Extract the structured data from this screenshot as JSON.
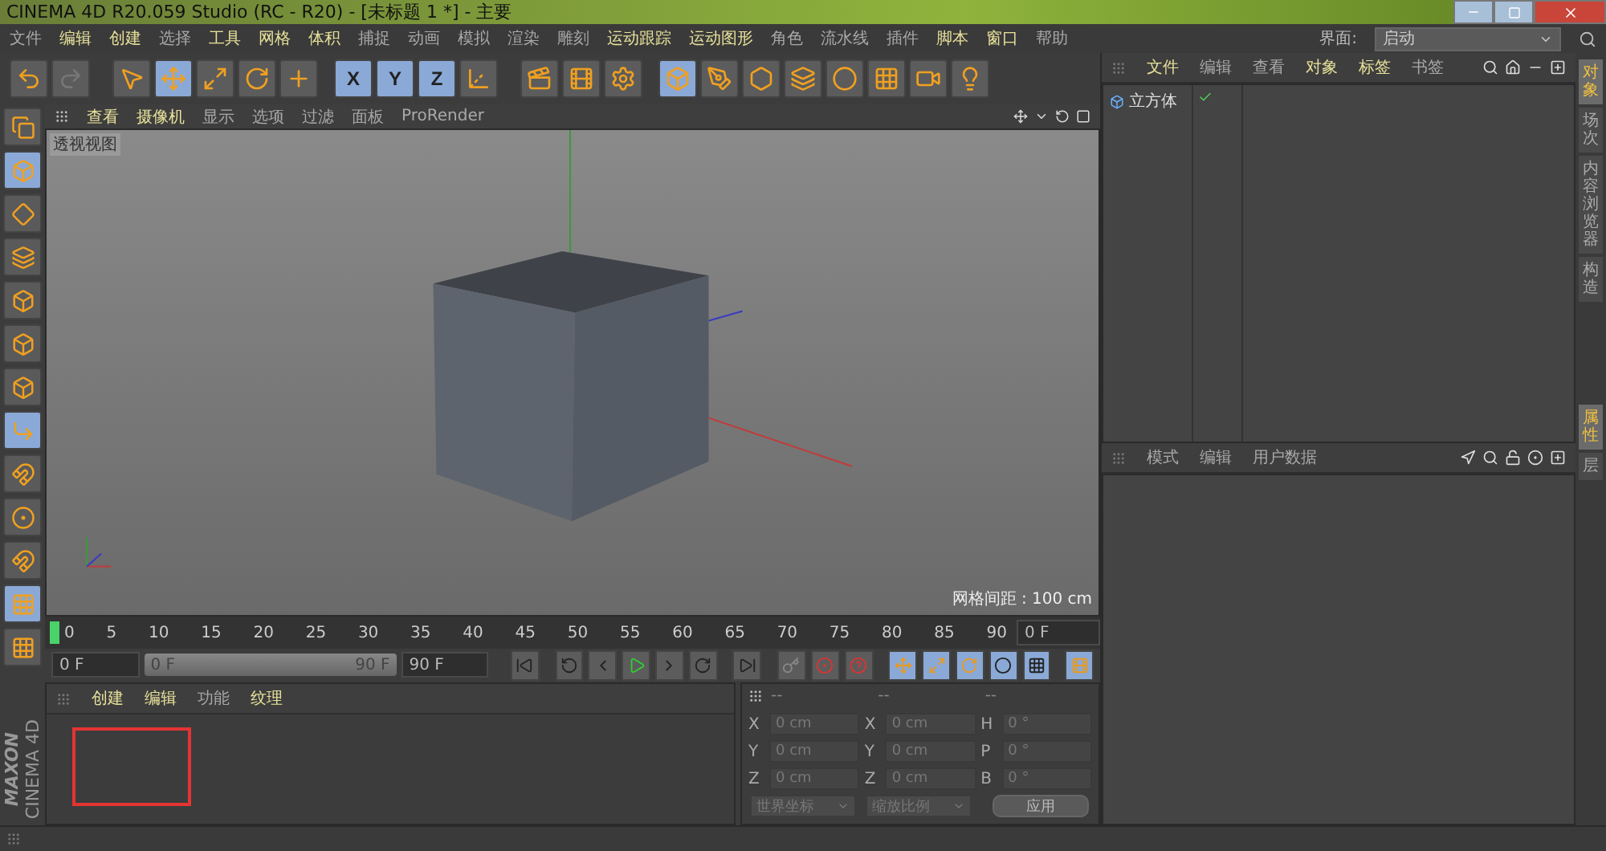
{
  "window": {
    "title": "CINEMA 4D R20.059 Studio (RC - R20) - [未标题 1 *] - 主要"
  },
  "menu": [
    {
      "label": "文件",
      "highlighted": false
    },
    {
      "label": "编辑",
      "highlighted": true
    },
    {
      "label": "创建",
      "highlighted": true
    },
    {
      "label": "选择",
      "highlighted": false
    },
    {
      "label": "工具",
      "highlighted": true
    },
    {
      "label": "网格",
      "highlighted": true
    },
    {
      "label": "体积",
      "highlighted": true
    },
    {
      "label": "捕捉",
      "highlighted": false
    },
    {
      "label": "动画",
      "highlighted": false
    },
    {
      "label": "模拟",
      "highlighted": false
    },
    {
      "label": "渲染",
      "highlighted": false
    },
    {
      "label": "雕刻",
      "highlighted": false
    },
    {
      "label": "运动跟踪",
      "highlighted": true
    },
    {
      "label": "运动图形",
      "highlighted": true
    },
    {
      "label": "角色",
      "highlighted": false
    },
    {
      "label": "流水线",
      "highlighted": false
    },
    {
      "label": "插件",
      "highlighted": false
    },
    {
      "label": "脚本",
      "highlighted": true
    },
    {
      "label": "窗口",
      "highlighted": true
    },
    {
      "label": "帮助",
      "highlighted": false
    }
  ],
  "layout_selector": {
    "label": "界面:",
    "value": "启动"
  },
  "toolbar": [
    {
      "kind": "icon",
      "active": false
    },
    {
      "kind": "icon",
      "active": false
    },
    {
      "kind": "icon",
      "active": false
    },
    {
      "kind": "icon",
      "active": true
    },
    {
      "kind": "icon",
      "active": false
    },
    {
      "kind": "icon",
      "active": false
    },
    {
      "kind": "icon",
      "active": false
    },
    {
      "kind": "axis",
      "label": "X",
      "active": true
    },
    {
      "kind": "axis",
      "label": "Y",
      "active": true
    },
    {
      "kind": "axis",
      "label": "Z",
      "active": true
    },
    {
      "kind": "icon",
      "active": false
    },
    {
      "kind": "icon",
      "active": false
    },
    {
      "kind": "icon",
      "active": false
    },
    {
      "kind": "icon",
      "active": false
    },
    {
      "kind": "icon",
      "active": true
    },
    {
      "kind": "icon",
      "active": false
    },
    {
      "kind": "icon",
      "active": false
    },
    {
      "kind": "icon",
      "active": false
    },
    {
      "kind": "icon",
      "active": false
    },
    {
      "kind": "icon",
      "active": false
    },
    {
      "kind": "icon",
      "active": false
    },
    {
      "kind": "icon",
      "active": false
    }
  ],
  "left_tools": [
    {
      "active": false
    },
    {
      "active": true
    },
    {
      "active": false
    },
    {
      "active": false
    },
    {
      "active": false
    },
    {
      "active": false
    },
    {
      "active": false
    },
    {
      "active": true
    },
    {
      "active": false
    },
    {
      "active": false
    },
    {
      "active": false
    },
    {
      "active": true
    },
    {
      "active": false
    }
  ],
  "viewport": {
    "menu": [
      {
        "label": "查看",
        "highlighted": true
      },
      {
        "label": "摄像机",
        "highlighted": true
      },
      {
        "label": "显示",
        "highlighted": false
      },
      {
        "label": "选项",
        "highlighted": false
      },
      {
        "label": "过滤",
        "highlighted": false
      },
      {
        "label": "面板",
        "highlighted": false
      },
      {
        "label": "ProRender",
        "highlighted": false
      }
    ],
    "view_name": "透视视图",
    "grid_spacing": "网格间距 : 100 cm"
  },
  "timeline": {
    "ticks": [
      "0",
      "5",
      "10",
      "15",
      "20",
      "25",
      "30",
      "35",
      "40",
      "45",
      "50",
      "55",
      "60",
      "65",
      "70",
      "75",
      "80",
      "85",
      "90"
    ],
    "current": "0 F",
    "start": "0 F",
    "range": {
      "start": "0 F",
      "end": "90 F",
      "level": 1
    },
    "end": "90 F"
  },
  "materials": {
    "menu": [
      {
        "label": "创建",
        "highlighted": true
      },
      {
        "label": "编辑",
        "highlighted": true
      },
      {
        "label": "功能",
        "highlighted": false
      },
      {
        "label": "纹理",
        "highlighted": true
      }
    ]
  },
  "coordinates": {
    "headers": [
      "--",
      "--",
      "--"
    ],
    "rows": [
      {
        "axis": "X",
        "position": "0 cm",
        "size_axis": "X",
        "size": "0 cm",
        "rot_axis": "H",
        "rotation": "0 °"
      },
      {
        "axis": "Y",
        "position": "0 cm",
        "size_axis": "Y",
        "size": "0 cm",
        "rot_axis": "P",
        "rotation": "0 °"
      },
      {
        "axis": "Z",
        "position": "0 cm",
        "size_axis": "Z",
        "size": "0 cm",
        "rot_axis": "B",
        "rotation": "0 °"
      }
    ],
    "mode": "世界坐标",
    "scale": "缩放比例",
    "apply": "应用"
  },
  "logo": {
    "brand": "MAXON",
    "product": "CINEMA 4D"
  },
  "objects": {
    "menu": [
      {
        "label": "文件",
        "highlighted": true
      },
      {
        "label": "编辑",
        "highlighted": false
      },
      {
        "label": "查看",
        "highlighted": false
      },
      {
        "label": "对象",
        "highlighted": true
      },
      {
        "label": "标签",
        "highlighted": true
      },
      {
        "label": "书签",
        "highlighted": false
      }
    ],
    "items": [
      {
        "name": "立方体",
        "enabled": true
      }
    ]
  },
  "attributes": {
    "menu": [
      {
        "label": "模式",
        "highlighted": false
      },
      {
        "label": "编辑",
        "highlighted": false
      },
      {
        "label": "用户数据",
        "highlighted": false
      }
    ]
  },
  "side_tabs": [
    {
      "label": "对象",
      "selected": true
    },
    {
      "label": "场次",
      "selected": false
    },
    {
      "label": "内容浏览器",
      "selected": false
    },
    {
      "label": "构造",
      "selected": false
    }
  ],
  "side_tabs_lower": [
    {
      "label": "属性",
      "selected": true
    },
    {
      "label": "层",
      "selected": false
    }
  ]
}
